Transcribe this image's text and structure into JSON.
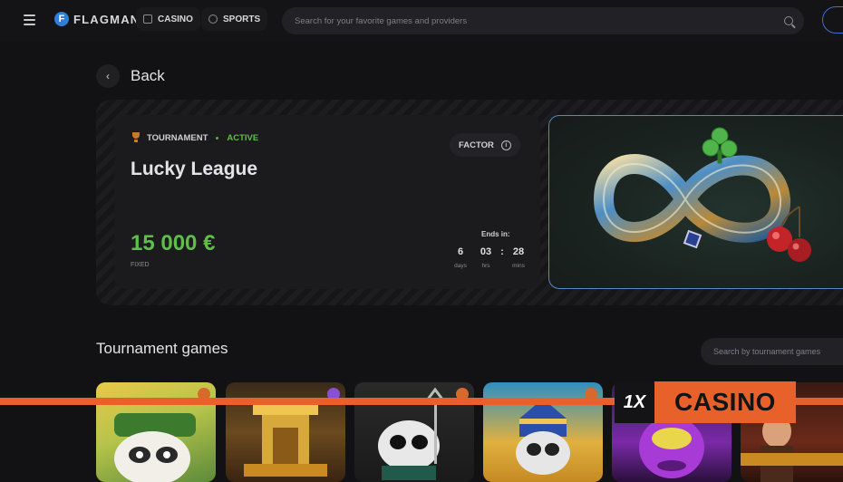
{
  "header": {
    "logo_mark": "F",
    "logo_text": "FLAGMAN",
    "nav": [
      {
        "label": "CASINO",
        "icon": "casino-icon"
      },
      {
        "label": "SPORTS",
        "icon": "sports-ball-icon"
      }
    ],
    "search_placeholder": "Search for your favorite games and providers"
  },
  "back": {
    "label": "Back"
  },
  "tournament": {
    "type_label": "TOURNAMENT",
    "status": "ACTIVE",
    "factor_label": "FACTOR",
    "title": "Lucky League",
    "prize": "15 000 €",
    "prize_type": "FIXED",
    "ends_label": "Ends in:",
    "timer": [
      {
        "value": "6",
        "unit": "days"
      },
      {
        "value": "03",
        "unit": "hrs"
      },
      {
        "value": "28",
        "unit": "mins"
      }
    ],
    "image_icon": "infinity-clover-cherries-icon"
  },
  "games_section": {
    "title": "Tournament games",
    "search_placeholder": "Search by tournament games"
  },
  "games": [
    {
      "name": "raccoon-bandit-game",
      "badge": "orange"
    },
    {
      "name": "egyptian-temple-game",
      "badge": "purple"
    },
    {
      "name": "devil-raccoon-game",
      "badge": "orange"
    },
    {
      "name": "pharaoh-raccoon-game",
      "badge": "orange"
    },
    {
      "name": "purple-monster-game",
      "badge": "none"
    },
    {
      "name": "book-of-game",
      "badge": "none"
    }
  ],
  "watermark": {
    "mark": "1X",
    "text": "CASINO"
  },
  "colors": {
    "accent_green": "#5fbe4a",
    "brand_orange": "#e8612a",
    "link_blue": "#3d6fd6"
  }
}
